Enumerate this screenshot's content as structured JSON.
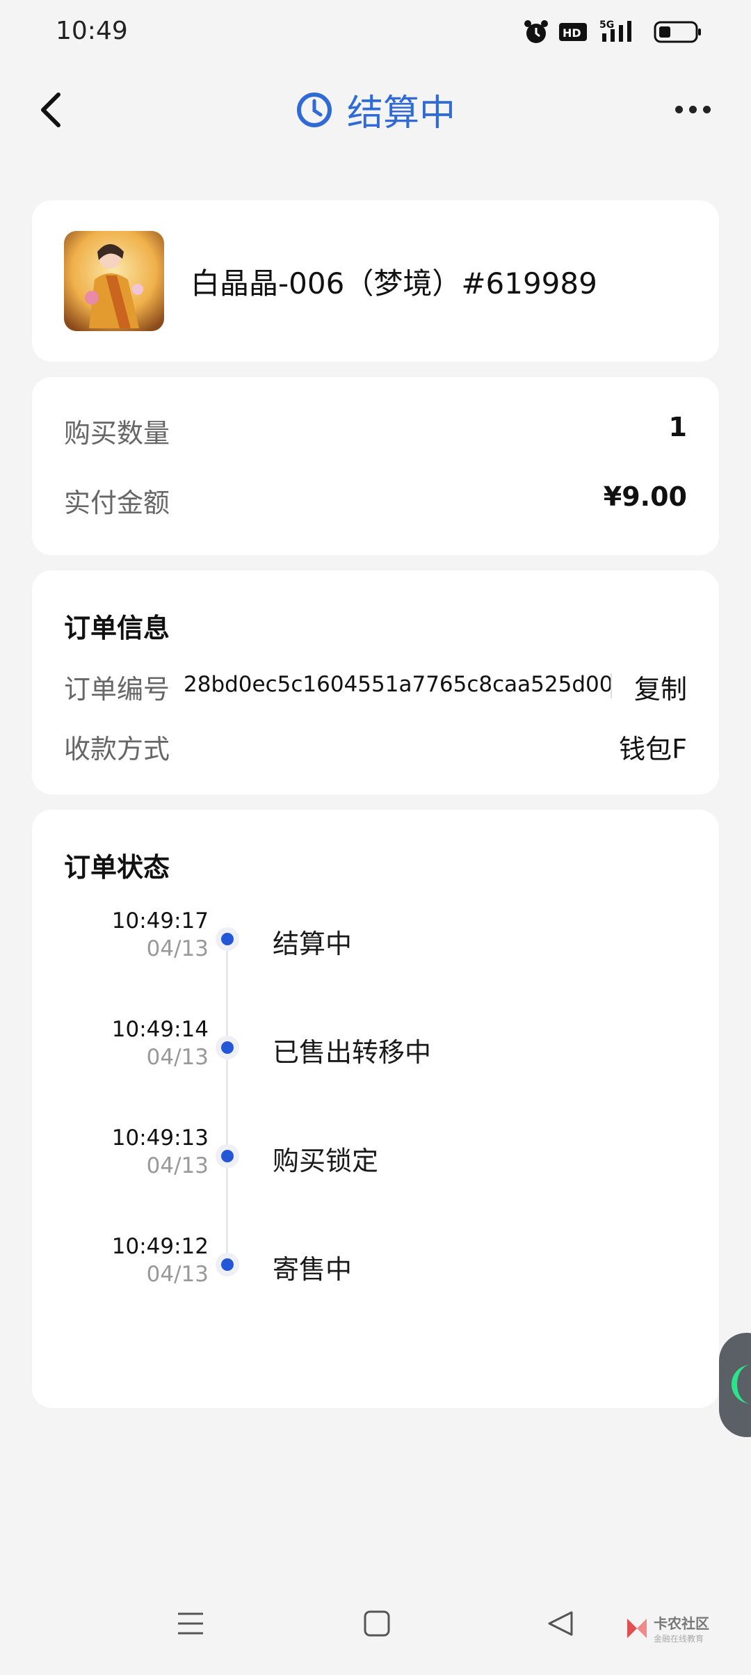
{
  "status_bar": {
    "time": "10:49",
    "network": "5G",
    "hd": "HD2"
  },
  "header": {
    "title": "结算中"
  },
  "product": {
    "name": "白晶晶-006（梦境）#619989"
  },
  "purchase": {
    "quantity_label": "购买数量",
    "quantity_value": "1",
    "amount_label": "实付金额",
    "amount_value": "¥9.00"
  },
  "order_info": {
    "title": "订单信息",
    "number_label": "订单编号",
    "number_value": "28bd0ec5c1604551a7765c8caa525d00",
    "copy_label": "复制",
    "payment_label": "收款方式",
    "payment_value": "钱包F"
  },
  "order_status": {
    "title": "订单状态",
    "events": [
      {
        "time": "10:49:17",
        "date": "04/13",
        "text": "结算中"
      },
      {
        "time": "10:49:14",
        "date": "04/13",
        "text": "已售出转移中"
      },
      {
        "time": "10:49:13",
        "date": "04/13",
        "text": "购买锁定"
      },
      {
        "time": "10:49:12",
        "date": "04/13",
        "text": "寄售中"
      }
    ]
  },
  "watermark": {
    "name": "卡农社区",
    "tagline": "金融在线教育"
  },
  "colors": {
    "accent": "#2f6ad6",
    "dot": "#2456d8",
    "background": "#f4f4f5"
  }
}
